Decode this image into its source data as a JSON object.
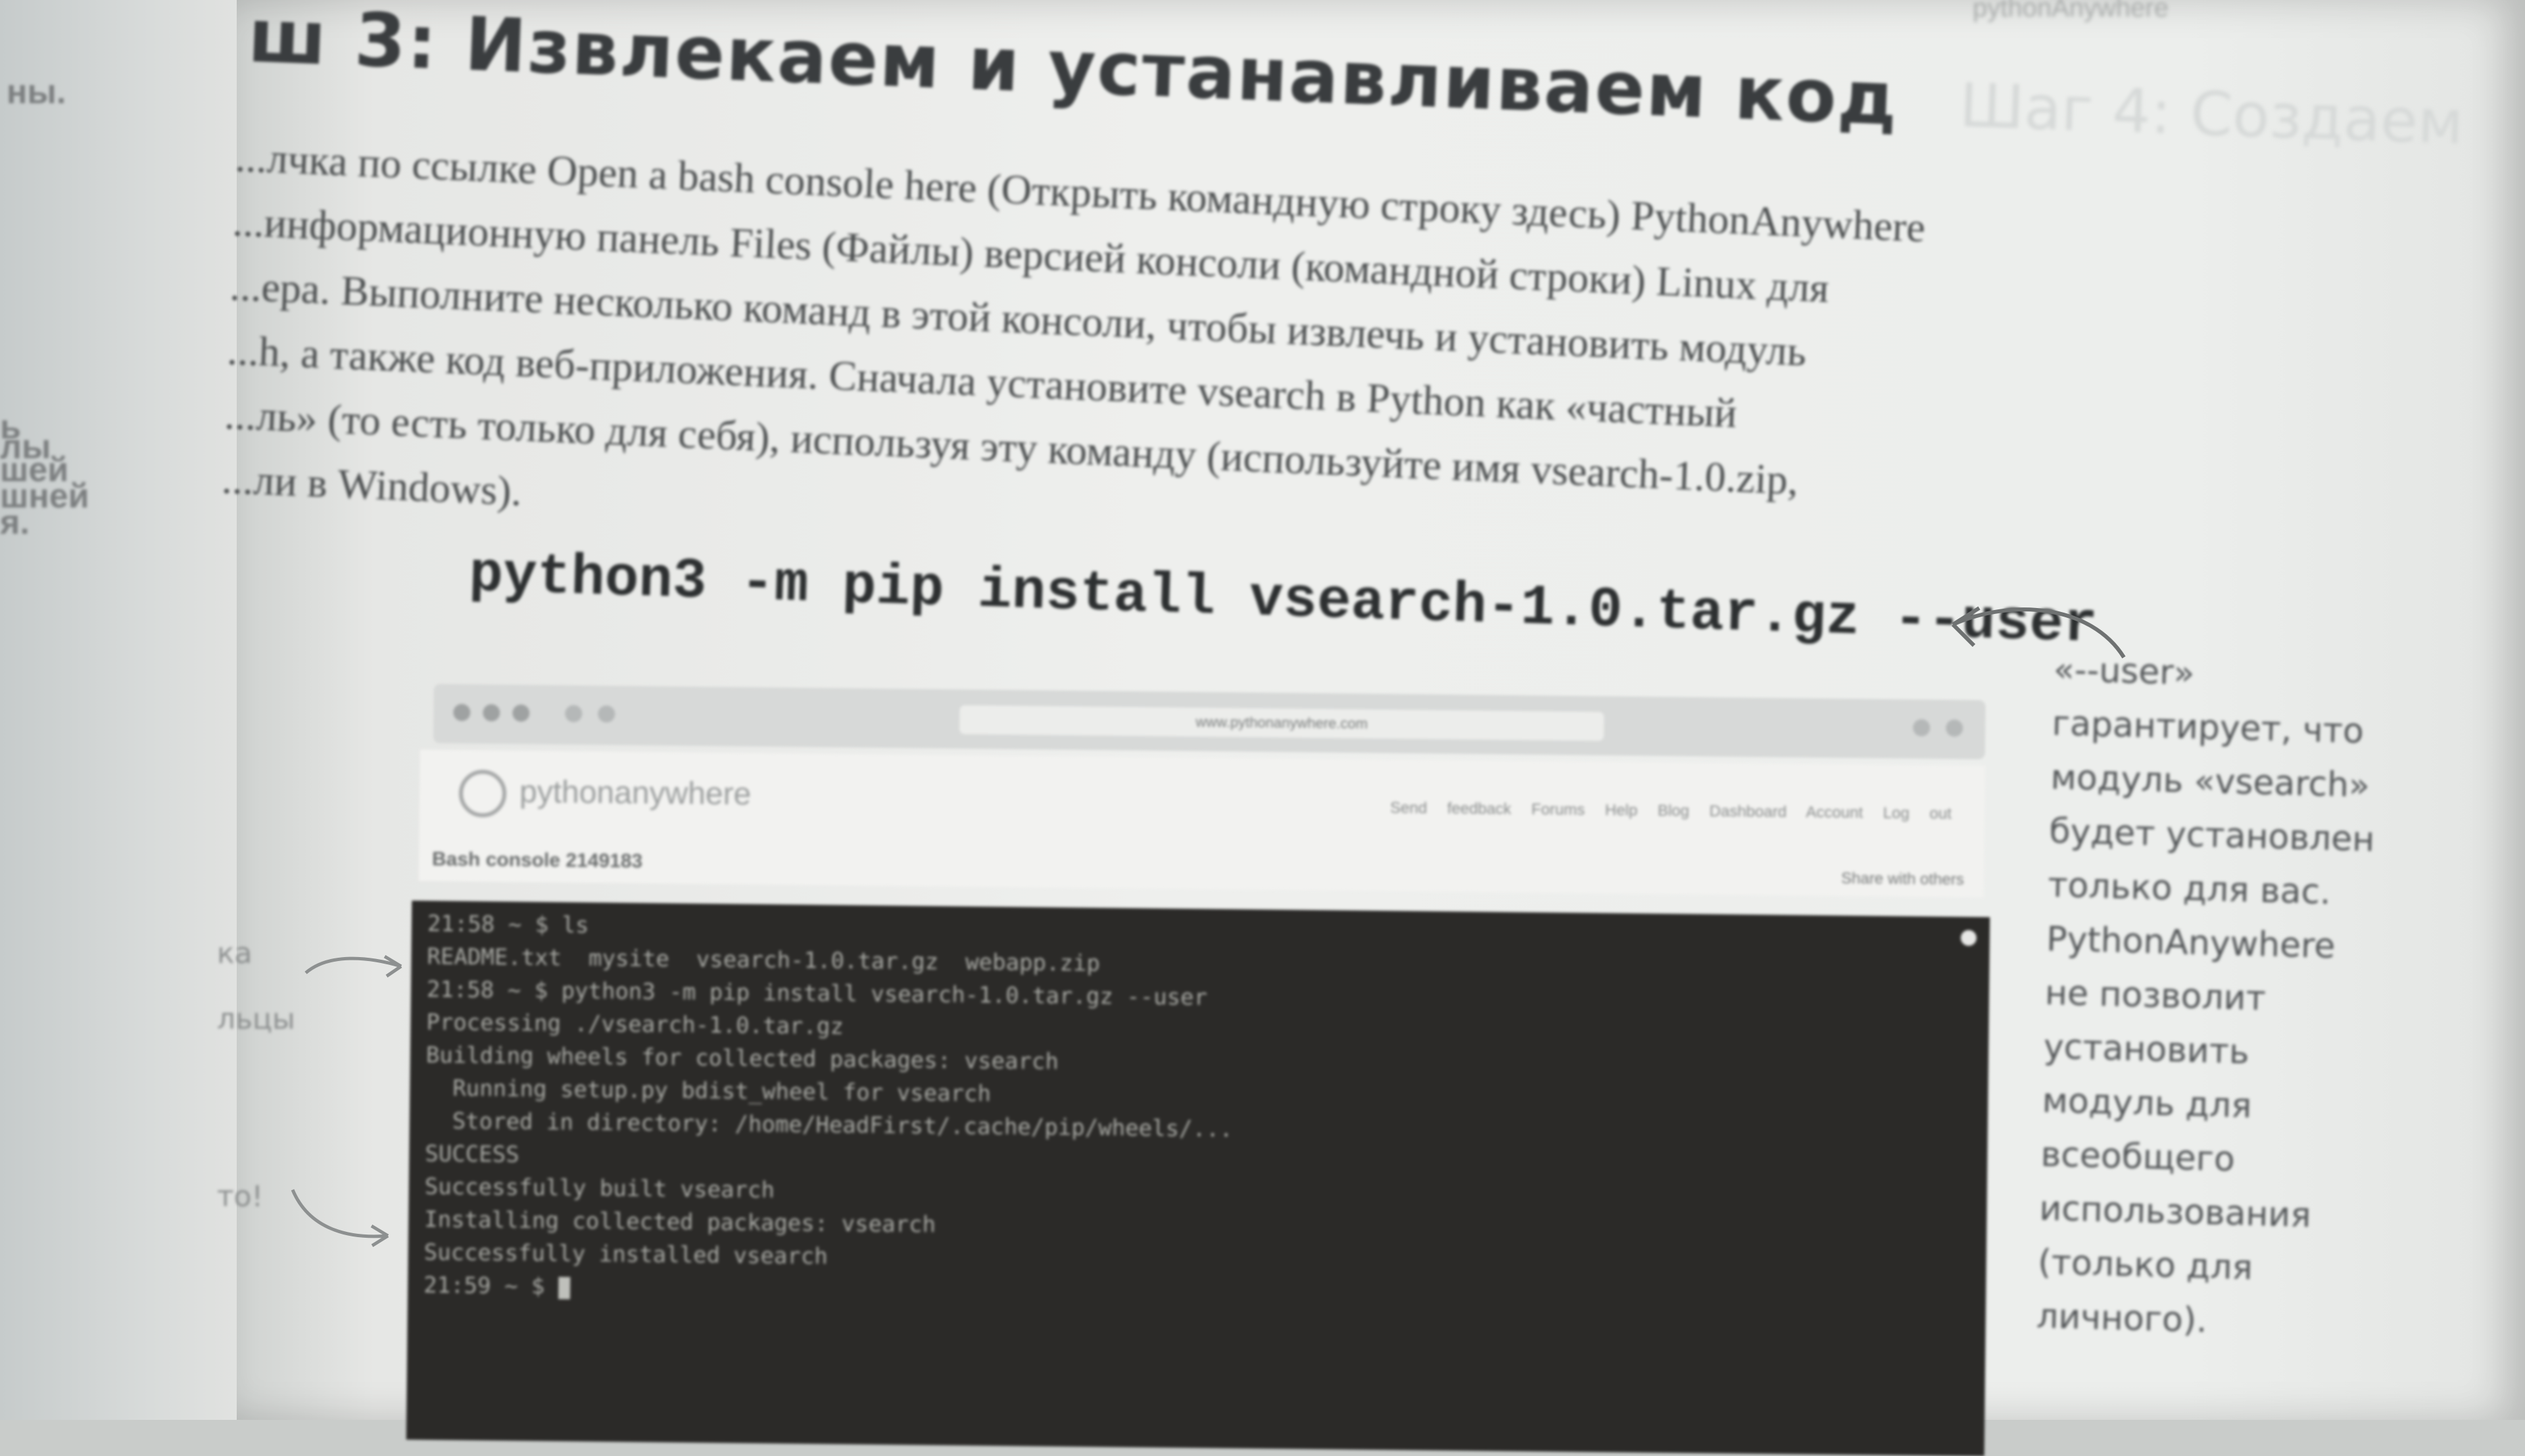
{
  "left_page": {
    "fragments": [
      "ны.",
      "ь",
      "лы",
      "шей",
      "шней",
      "я."
    ]
  },
  "book": {
    "corner_label": "pythonAnywhere",
    "heading": "ш 3: Извлекаем и устанавливаем код",
    "side_heading": "Шаг 4: Создаем",
    "paragraph_lines": [
      "...лчка по ссылке Open a bash console here (Открыть командную строку здесь) PythonAnywhere",
      "...информационную панель Files (Файлы) версией консоли (командной строки) Linux для",
      "...ера. Выполните несколько команд в этой консоли, чтобы извлечь и установить модуль",
      "...h, а также код веб-приложения. Сначала установите vsearch в Python как «частный",
      "...ль» (то есть только для себя), используя эту команду (используйте имя vsearch-1.0.zip,",
      "...ли в Windows)."
    ],
    "command": "python3 -m pip install vsearch-1.0.tar.gz --user",
    "annotation_lines": [
      "«--user»",
      "гарантирует, что",
      "модуль «vsearch»",
      "будет установлен",
      "только для вас.",
      "PythonAnywhere",
      "не позволит",
      "установить",
      "модуль для",
      "всеобщего",
      "использования",
      "(только для",
      "личного)."
    ],
    "margin_callouts": [
      "ка",
      "льцы",
      "то!"
    ]
  },
  "screenshot": {
    "url": "www.pythonanywhere.com",
    "logo_text": "pythonanywhere",
    "nav": "Send feedback Forums Help Blog Dashboard Account Log out",
    "console_title": "Bash console 2149183",
    "share_label": "Share with others",
    "terminal_lines": [
      "21:58 ~ $ ls",
      "README.txt  mysite  vsearch-1.0.tar.gz  webapp.zip",
      "21:58 ~ $ python3 -m pip install vsearch-1.0.tar.gz --user",
      "Processing ./vsearch-1.0.tar.gz",
      "Building wheels for collected packages: vsearch",
      "  Running setup.py bdist_wheel for vsearch",
      "  Stored in directory: /home/HeadFirst/.cache/pip/wheels/...",
      "SUCCESS",
      "Successfully built vsearch",
      "Installing collected packages: vsearch",
      "Successfully installed vsearch",
      "21:59 ~ $ "
    ]
  }
}
